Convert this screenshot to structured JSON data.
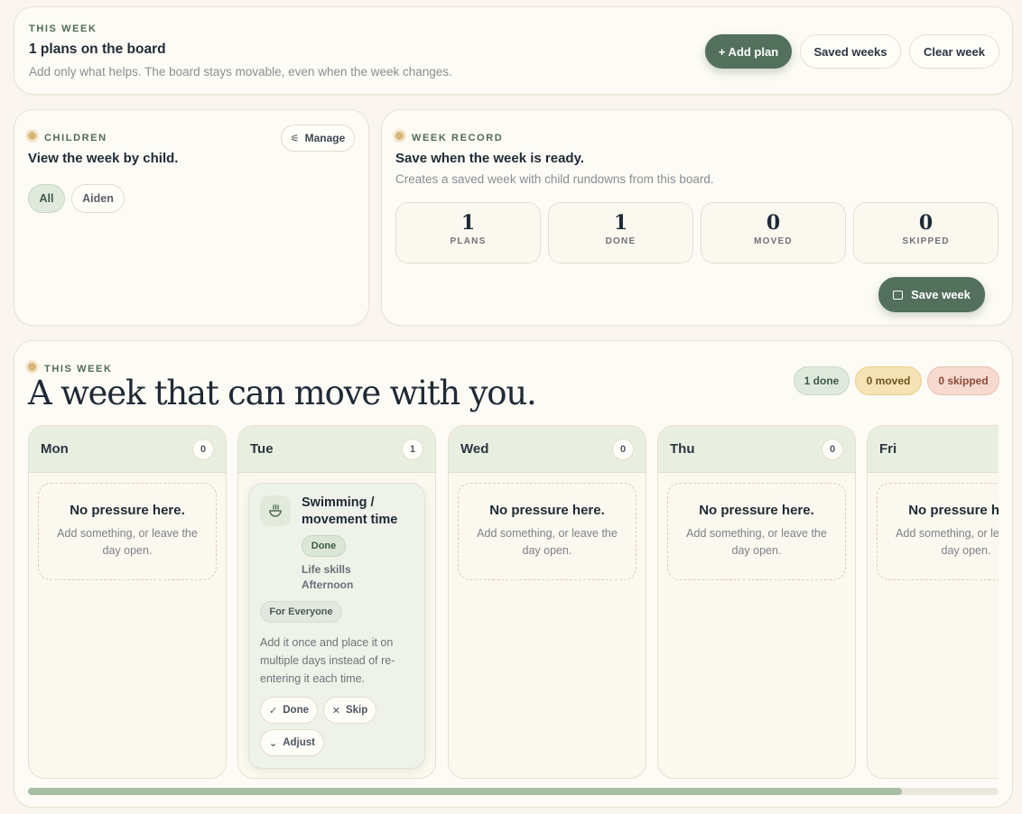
{
  "header": {
    "eyebrow": "THIS WEEK",
    "title": "1 plans on the board",
    "subtitle": "Add only what helps. The board stays movable, even when the week changes.",
    "add_plan": "+ Add plan",
    "saved_weeks": "Saved weeks",
    "clear_week": "Clear week"
  },
  "children": {
    "eyebrow": "CHILDREN",
    "title": "View the week by child.",
    "manage": "Manage",
    "filters": [
      "All",
      "Aiden"
    ]
  },
  "record": {
    "eyebrow": "WEEK RECORD",
    "title": "Save when the week is ready.",
    "subtitle": "Creates a saved week with child rundowns from this board.",
    "stats": [
      {
        "value": "1",
        "label": "PLANS"
      },
      {
        "value": "1",
        "label": "DONE"
      },
      {
        "value": "0",
        "label": "MOVED"
      },
      {
        "value": "0",
        "label": "SKIPPED"
      }
    ],
    "save": "Save week"
  },
  "week": {
    "eyebrow": "THIS WEEK",
    "title": "A week that can move with you.",
    "badges": {
      "done": "1 done",
      "moved": "0 moved",
      "skipped": "0 skipped"
    },
    "empty_title": "No pressure here.",
    "empty_sub": "Add something, or leave the day open.",
    "days": [
      {
        "name": "Mon",
        "count": "0"
      },
      {
        "name": "Tue",
        "count": "1"
      },
      {
        "name": "Wed",
        "count": "0"
      },
      {
        "name": "Thu",
        "count": "0"
      },
      {
        "name": "Fri",
        "count": "0"
      }
    ],
    "plan": {
      "title": "Swimming / movement time",
      "status": "Done",
      "category": "Life skills",
      "time": "Afternoon",
      "audience": "For Everyone",
      "note": "Add it once and place it on multiple days instead of re-entering it each time.",
      "done_label": "Done",
      "skip_label": "Skip",
      "adjust_label": "Adjust"
    },
    "scroll_position": 0.9
  },
  "colors": {
    "accent": "#53705d",
    "background": "#faf6ef",
    "card": "#fdfbf5",
    "day_header": "#e8efe1",
    "done_badge": "#dfe9dc",
    "moved_badge": "#f5e3b5",
    "skipped_badge": "#f6d9cf"
  }
}
